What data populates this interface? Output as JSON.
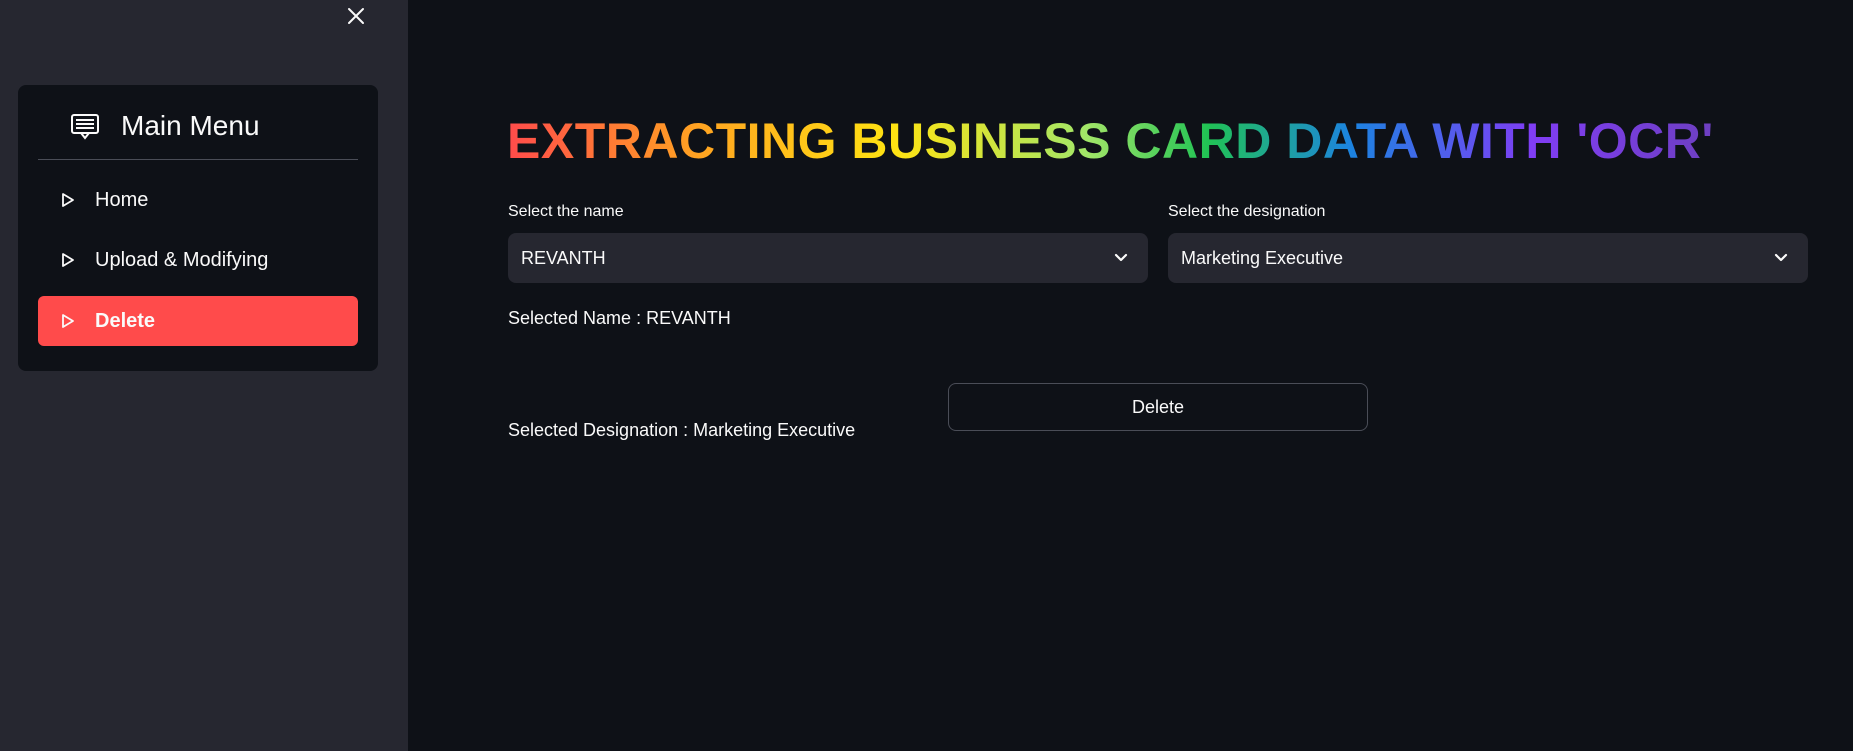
{
  "sidebar": {
    "close_icon": "close-icon",
    "menu": {
      "icon": "menu-list-icon",
      "title": "Main Menu",
      "items": [
        {
          "label": "Home",
          "icon": "play-outline-icon",
          "active": false
        },
        {
          "label": "Upload & Modifying",
          "icon": "play-outline-icon",
          "active": false
        },
        {
          "label": "Delete",
          "icon": "play-outline-icon",
          "active": true
        }
      ]
    },
    "active_color": "#ff4b4b"
  },
  "main": {
    "title": "EXTRACTING BUSINESS CARD DATA WITH 'OCR'",
    "name_select": {
      "label": "Select the name",
      "value": "REVANTH"
    },
    "designation_select": {
      "label": "Select the designation",
      "value": "Marketing Executive"
    },
    "selected_name_text": "Selected Name : REVANTH",
    "selected_designation_text": "Selected Designation : Marketing Executive",
    "delete_button_label": "Delete"
  }
}
